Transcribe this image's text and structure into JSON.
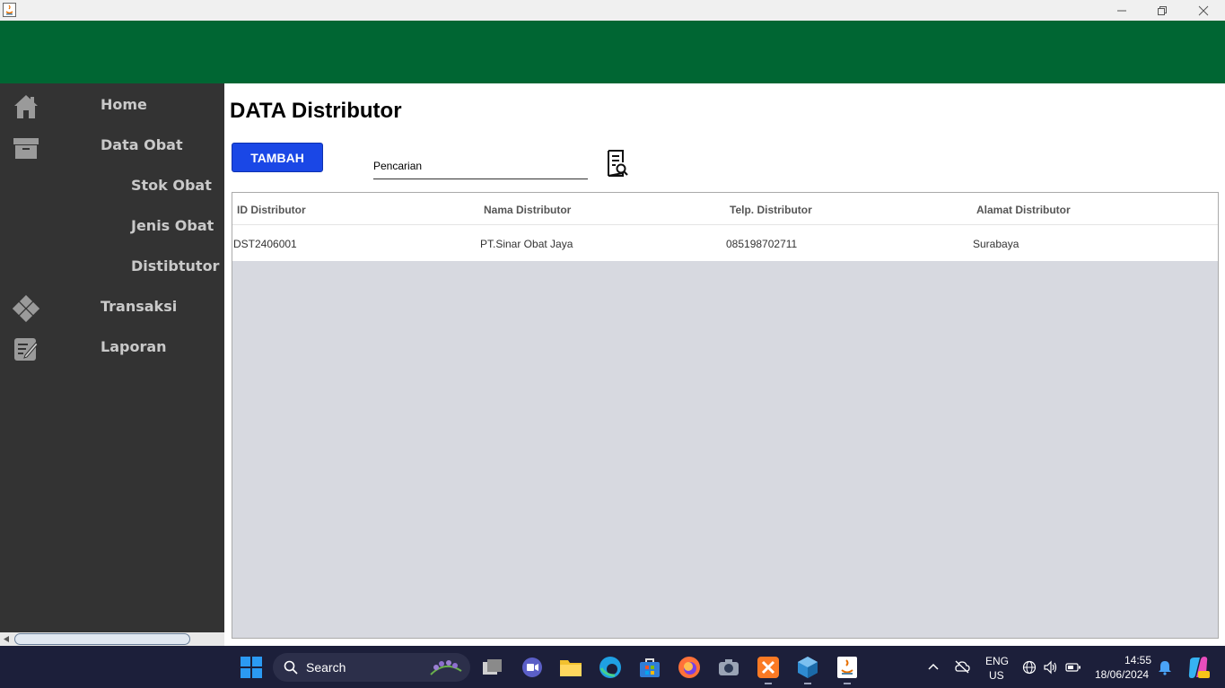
{
  "window": {
    "controls": [
      "minimize",
      "restore",
      "close"
    ]
  },
  "sidebar": {
    "items": [
      {
        "label": "Home",
        "icon": "home-icon"
      },
      {
        "label": "Data Obat",
        "icon": "archive-icon"
      },
      {
        "label": "Stok Obat"
      },
      {
        "label": "Jenis Obat"
      },
      {
        "label": "Distibtutor"
      },
      {
        "label": "Transaksi",
        "icon": "transaction-icon"
      },
      {
        "label": "Laporan",
        "icon": "report-icon"
      }
    ]
  },
  "main": {
    "title": "DATA Distributor",
    "add_button": "TAMBAH",
    "search_value": "Pencarian",
    "table": {
      "columns": [
        "ID Distributor",
        "Nama Distributor",
        "Telp. Distributor",
        "Alamat Distributor"
      ],
      "rows": [
        [
          "DST2406001",
          "PT.Sinar Obat Jaya",
          "085198702711",
          "Surabaya"
        ]
      ]
    }
  },
  "taskbar": {
    "search_label": "Search",
    "lang_line1": "ENG",
    "lang_line2": "US",
    "time": "14:55",
    "date": "18/06/2024"
  },
  "colors": {
    "header": "#006633",
    "sidebar": "#333333",
    "button": "#1a47e6",
    "taskbar": "#1c1f3a"
  }
}
